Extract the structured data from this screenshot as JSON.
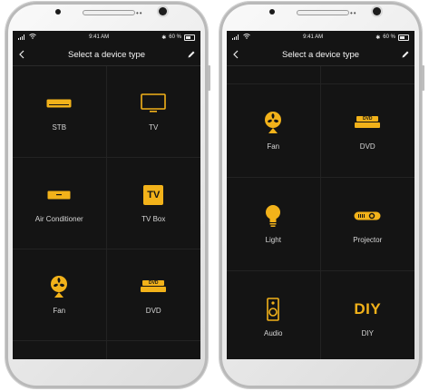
{
  "colors": {
    "accent": "#F2B21A",
    "screen_bg": "#141414",
    "text": "#D6D6D6"
  },
  "phones": [
    {
      "status": {
        "time": "9:41 AM",
        "battery": "60 %"
      },
      "header": {
        "title": "Select a device type"
      },
      "devices": [
        {
          "label": "STB",
          "icon": "stb-icon"
        },
        {
          "label": "TV",
          "icon": "tv-icon"
        },
        {
          "label": "Air Conditioner",
          "icon": "air-conditioner-icon"
        },
        {
          "label": "TV Box",
          "icon": "tv-box-icon",
          "icon_text": "TV"
        },
        {
          "label": "Fan",
          "icon": "fan-icon"
        },
        {
          "label": "DVD",
          "icon": "dvd-icon",
          "icon_text": "DVD"
        }
      ]
    },
    {
      "status": {
        "time": "9:41 AM",
        "battery": "60 %"
      },
      "header": {
        "title": "Select a device type"
      },
      "devices": [
        {
          "label": "Fan",
          "icon": "fan-icon"
        },
        {
          "label": "DVD",
          "icon": "dvd-icon",
          "icon_text": "DVD"
        },
        {
          "label": "Light",
          "icon": "light-bulb-icon"
        },
        {
          "label": "Projector",
          "icon": "projector-icon"
        },
        {
          "label": "Audio",
          "icon": "speaker-icon"
        },
        {
          "label": "DIY",
          "icon": "diy-icon",
          "icon_text": "DIY"
        }
      ]
    }
  ]
}
